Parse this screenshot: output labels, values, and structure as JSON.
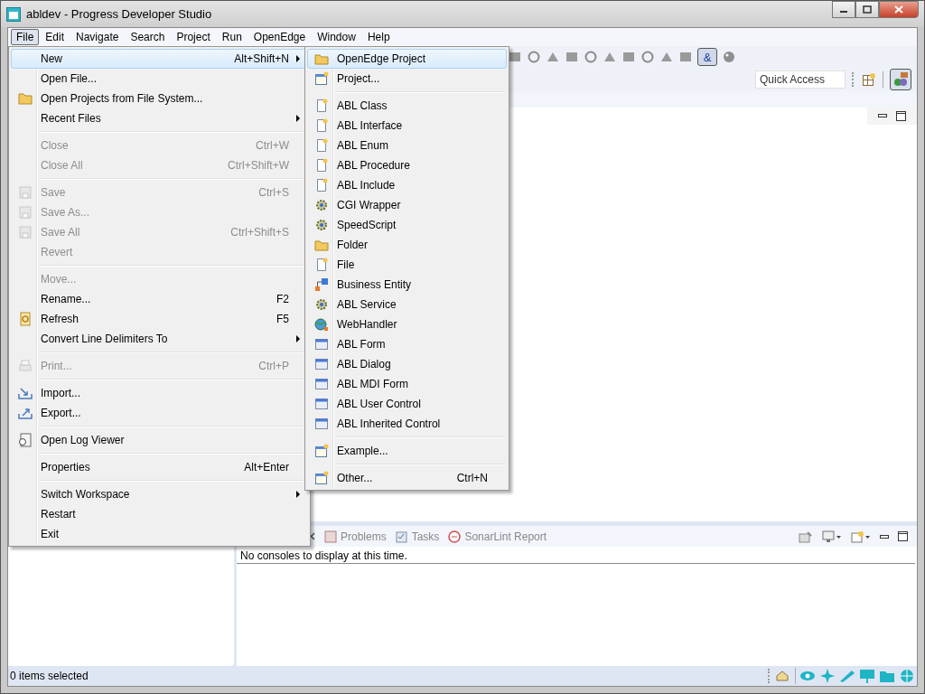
{
  "window": {
    "title": "abldev - Progress Developer Studio"
  },
  "menu_bar": [
    {
      "label": "File",
      "selected": true
    },
    {
      "label": "Edit",
      "selected": false
    },
    {
      "label": "Navigate",
      "selected": false
    },
    {
      "label": "Search",
      "selected": false
    },
    {
      "label": "Project",
      "selected": false
    },
    {
      "label": "Run",
      "selected": false
    },
    {
      "label": "OpenEdge",
      "selected": false
    },
    {
      "label": "Window",
      "selected": false
    },
    {
      "label": "Help",
      "selected": false
    }
  ],
  "toolbar": {
    "toggle": {
      "label": "&",
      "selected": true
    },
    "quick_access": {
      "placeholder": "Quick Access"
    }
  },
  "file_menu": {
    "items": [
      {
        "kind": "item",
        "label": "New",
        "shortcut": "Alt+Shift+N",
        "submenu": true,
        "disabled": false,
        "selected": true
      },
      {
        "kind": "item",
        "label": "Open File...",
        "submenu": false,
        "disabled": false,
        "selected": false
      },
      {
        "kind": "item",
        "label": "Open Projects from File System...",
        "submenu": false,
        "disabled": false,
        "selected": false
      },
      {
        "kind": "item",
        "label": "Recent Files",
        "submenu": true,
        "disabled": false,
        "selected": false
      },
      {
        "kind": "separator"
      },
      {
        "kind": "item",
        "label": "Close",
        "shortcut": "Ctrl+W",
        "submenu": false,
        "disabled": true,
        "selected": false
      },
      {
        "kind": "item",
        "label": "Close All",
        "shortcut": "Ctrl+Shift+W",
        "submenu": false,
        "disabled": true,
        "selected": false
      },
      {
        "kind": "separator"
      },
      {
        "kind": "item",
        "label": "Save",
        "shortcut": "Ctrl+S",
        "submenu": false,
        "disabled": true,
        "selected": false
      },
      {
        "kind": "item",
        "label": "Save As...",
        "submenu": false,
        "disabled": true,
        "selected": false
      },
      {
        "kind": "item",
        "label": "Save All",
        "shortcut": "Ctrl+Shift+S",
        "submenu": false,
        "disabled": true,
        "selected": false
      },
      {
        "kind": "item",
        "label": "Revert",
        "submenu": false,
        "disabled": true,
        "selected": false
      },
      {
        "kind": "separator"
      },
      {
        "kind": "item",
        "label": "Move...",
        "submenu": false,
        "disabled": true,
        "selected": false
      },
      {
        "kind": "item",
        "label": "Rename...",
        "shortcut": "F2",
        "submenu": false,
        "disabled": false,
        "selected": false
      },
      {
        "kind": "item",
        "label": "Refresh",
        "shortcut": "F5",
        "submenu": false,
        "disabled": false,
        "selected": false
      },
      {
        "kind": "item",
        "label": "Convert Line Delimiters To",
        "submenu": true,
        "disabled": false,
        "selected": false
      },
      {
        "kind": "separator"
      },
      {
        "kind": "item",
        "label": "Print...",
        "shortcut": "Ctrl+P",
        "submenu": false,
        "disabled": true,
        "selected": false
      },
      {
        "kind": "separator"
      },
      {
        "kind": "item",
        "label": "Import...",
        "submenu": false,
        "disabled": false,
        "selected": false
      },
      {
        "kind": "item",
        "label": "Export...",
        "submenu": false,
        "disabled": false,
        "selected": false
      },
      {
        "kind": "separator"
      },
      {
        "kind": "item",
        "label": "Open Log Viewer",
        "submenu": false,
        "disabled": false,
        "selected": false
      },
      {
        "kind": "separator"
      },
      {
        "kind": "item",
        "label": "Properties",
        "shortcut": "Alt+Enter",
        "submenu": false,
        "disabled": false,
        "selected": false
      },
      {
        "kind": "separator"
      },
      {
        "kind": "item",
        "label": "Switch Workspace",
        "submenu": true,
        "disabled": false,
        "selected": false
      },
      {
        "kind": "item",
        "label": "Restart",
        "submenu": false,
        "disabled": false,
        "selected": false
      },
      {
        "kind": "item",
        "label": "Exit",
        "submenu": false,
        "disabled": false,
        "selected": false
      }
    ]
  },
  "new_submenu": {
    "items": [
      {
        "kind": "item",
        "label": "OpenEdge Project",
        "selected": true
      },
      {
        "kind": "item",
        "label": "Project...",
        "selected": false
      },
      {
        "kind": "separator"
      },
      {
        "kind": "item",
        "label": "ABL Class",
        "selected": false
      },
      {
        "kind": "item",
        "label": "ABL Interface",
        "selected": false
      },
      {
        "kind": "item",
        "label": "ABL Enum",
        "selected": false
      },
      {
        "kind": "item",
        "label": "ABL Procedure",
        "selected": false
      },
      {
        "kind": "item",
        "label": "ABL Include",
        "selected": false
      },
      {
        "kind": "item",
        "label": "CGI Wrapper",
        "selected": false
      },
      {
        "kind": "item",
        "label": "SpeedScript",
        "selected": false
      },
      {
        "kind": "item",
        "label": "Folder",
        "selected": false
      },
      {
        "kind": "item",
        "label": "File",
        "selected": false
      },
      {
        "kind": "item",
        "label": "Business Entity",
        "selected": false
      },
      {
        "kind": "item",
        "label": "ABL Service",
        "selected": false
      },
      {
        "kind": "item",
        "label": "WebHandler",
        "selected": false
      },
      {
        "kind": "item",
        "label": "ABL Form",
        "selected": false
      },
      {
        "kind": "item",
        "label": "ABL Dialog",
        "selected": false
      },
      {
        "kind": "item",
        "label": "ABL MDI Form",
        "selected": false
      },
      {
        "kind": "item",
        "label": "ABL User Control",
        "selected": false
      },
      {
        "kind": "item",
        "label": "ABL Inherited Control",
        "selected": false
      },
      {
        "kind": "separator"
      },
      {
        "kind": "item",
        "label": "Example...",
        "selected": false
      },
      {
        "kind": "separator"
      },
      {
        "kind": "item",
        "label": "Other...",
        "shortcut": "Ctrl+N",
        "selected": false
      }
    ]
  },
  "bottom_panel": {
    "tabs": [
      "Problems",
      "Tasks",
      "SonarLint Report"
    ],
    "message": "No consoles to display at this time."
  },
  "status_bar": {
    "text": "0 items selected"
  }
}
